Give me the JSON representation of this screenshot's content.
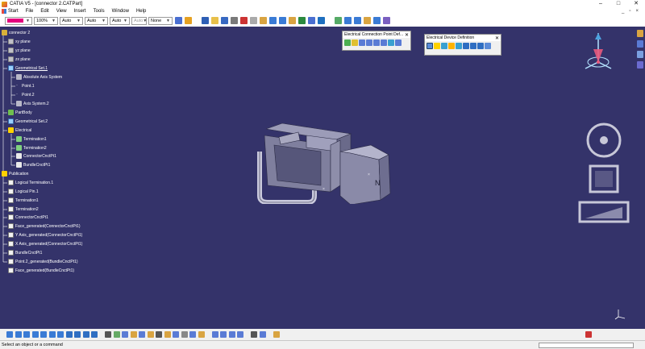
{
  "window": {
    "title": "CATIA V5 - [connector 2.CATPart]",
    "min": "–",
    "max": "□",
    "close": "✕"
  },
  "menu": {
    "items": [
      "Start",
      "File",
      "Edit",
      "View",
      "Insert",
      "Tools",
      "Window",
      "Help"
    ],
    "right": [
      "_",
      "▫",
      "×"
    ]
  },
  "toolbar": {
    "color_swatch": "#e3007d",
    "opacity": "100%",
    "combo1": "Auto",
    "combo2": "Auto",
    "combo3": "Auto",
    "combo4": "Auto",
    "layer": "None"
  },
  "tree": {
    "items": [
      {
        "label": "connector 2",
        "icon": "part-icon"
      },
      {
        "label": "xy plane",
        "icon": "plane-icon"
      },
      {
        "label": "yz plane",
        "icon": "plane-icon"
      },
      {
        "label": "zx plane",
        "icon": "plane-icon"
      },
      {
        "label": "Geometrical Set.1",
        "icon": "geometrical-set-icon"
      },
      {
        "label": "Absolute Axis System",
        "icon": "axis-system-icon"
      },
      {
        "label": "Point.1",
        "icon": "point-icon"
      },
      {
        "label": "Point.2",
        "icon": "point-icon"
      },
      {
        "label": "Axis System.2",
        "icon": "axis-system-icon"
      },
      {
        "label": "PartBody",
        "icon": "part-body-icon"
      },
      {
        "label": "Geometrical Set.2",
        "icon": "geometrical-set-icon"
      },
      {
        "label": "Electrical",
        "icon": "electrical-icon"
      },
      {
        "label": "Termination1",
        "icon": "termination-icon"
      },
      {
        "label": "Termination2",
        "icon": "termination-icon"
      },
      {
        "label": "ConnectorCnctPt1",
        "icon": "connector-point-icon"
      },
      {
        "label": "BundleCnctPt1",
        "icon": "bundle-point-icon"
      },
      {
        "label": "Publication",
        "icon": "publication-icon"
      },
      {
        "label": "Logical Termination.1",
        "icon": "published-item-icon"
      },
      {
        "label": "Logical Pin.1",
        "icon": "published-item-icon"
      },
      {
        "label": "Termination1",
        "icon": "published-item-icon"
      },
      {
        "label": "Termination2",
        "icon": "published-item-icon"
      },
      {
        "label": "ConnectorCnctPt1",
        "icon": "published-item-icon"
      },
      {
        "label": "Face_generated(ConnectorCnctPt1)",
        "icon": "published-item-icon"
      },
      {
        "label": "Y Axis_generated(ConnectorCnctPt1)",
        "icon": "published-item-icon"
      },
      {
        "label": "X Axis_generated(ConnectorCnctPt1)",
        "icon": "published-item-icon"
      },
      {
        "label": "BundleCnctPt1",
        "icon": "published-item-icon"
      },
      {
        "label": "Point.2_generated(BundleCnctPt1)",
        "icon": "published-item-icon"
      },
      {
        "label": "Face_generated(BundleCnctPt1)",
        "icon": "published-item-icon"
      }
    ]
  },
  "panels": {
    "connection_point": {
      "title": "Electrical Connection Point Def...",
      "close": "✕"
    },
    "device_definition": {
      "title": "Electrical Device Definition",
      "close": "✕"
    }
  },
  "status": {
    "prompt": "Select an object or a command"
  },
  "colors": {
    "background": "#34336a",
    "tree_text": "#ffffff"
  }
}
